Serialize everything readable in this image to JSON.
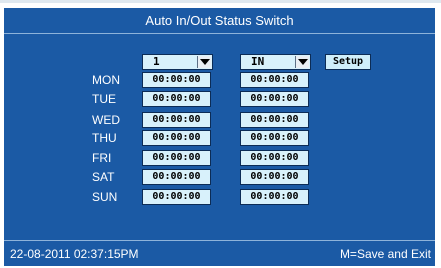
{
  "title": "Auto In/Out Status Switch",
  "selectors": {
    "number": "1",
    "status": "IN"
  },
  "buttons": {
    "setup": "Setup"
  },
  "days": [
    {
      "label": "MON",
      "time_a": "00:00:00",
      "time_b": "00:00:00"
    },
    {
      "label": "TUE",
      "time_a": "00:00:00",
      "time_b": "00:00:00"
    },
    {
      "label": "WED",
      "time_a": "00:00:00",
      "time_b": "00:00:00"
    },
    {
      "label": "THU",
      "time_a": "00:00:00",
      "time_b": "00:00:00"
    },
    {
      "label": "FRI",
      "time_a": "00:00:00",
      "time_b": "00:00:00"
    },
    {
      "label": "SAT",
      "time_a": "00:00:00",
      "time_b": "00:00:00"
    },
    {
      "label": "SUN",
      "time_a": "00:00:00",
      "time_b": "00:00:00"
    }
  ],
  "footer": {
    "datetime": "22-08-2011  02:37:15PM",
    "hint": "M=Save and Exit"
  },
  "colors": {
    "screen_bg": "#1b5aa5",
    "field_bg": "#d8f1fb",
    "text": "#ffffff"
  },
  "icons": {
    "dropdown": "chevron-down-icon"
  }
}
